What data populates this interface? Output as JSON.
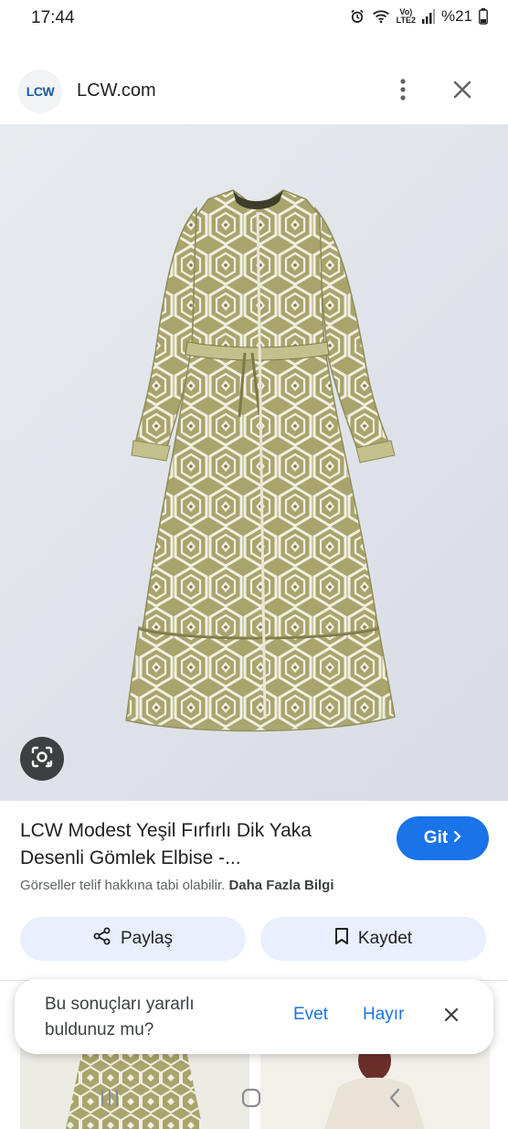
{
  "status_bar": {
    "time": "17:44",
    "network_label": "Vo)\nLTE2",
    "battery": "%21",
    "icons": [
      "alarm-icon",
      "wifi-icon",
      "signal-icon",
      "battery-icon"
    ]
  },
  "header": {
    "logo_text": "LCW",
    "site_name": "LCW.com",
    "icons": [
      "more-vert-icon",
      "close-icon"
    ]
  },
  "product": {
    "title": "LCW Modest Yeşil Fırfırlı Dik Yaka Desenli Gömlek Elbise -...",
    "visit_label": "Git",
    "copyright_notice": "Görseller telif hakkına tabi olabilir.",
    "more_info": "Daha Fazla Bilgi",
    "image_icon": "google-lens-icon"
  },
  "actions": {
    "share_label": "Paylaş",
    "save_label": "Kaydet"
  },
  "feedback": {
    "question": "Bu sonuçları yararlı buldunuz mu?",
    "yes_label": "Evet",
    "no_label": "Hayır"
  },
  "colors": {
    "accent": "#1a73e8",
    "pill_bg": "#e8f0fe",
    "dress_base": "#a8a46a",
    "dress_light": "#f1efe3"
  }
}
